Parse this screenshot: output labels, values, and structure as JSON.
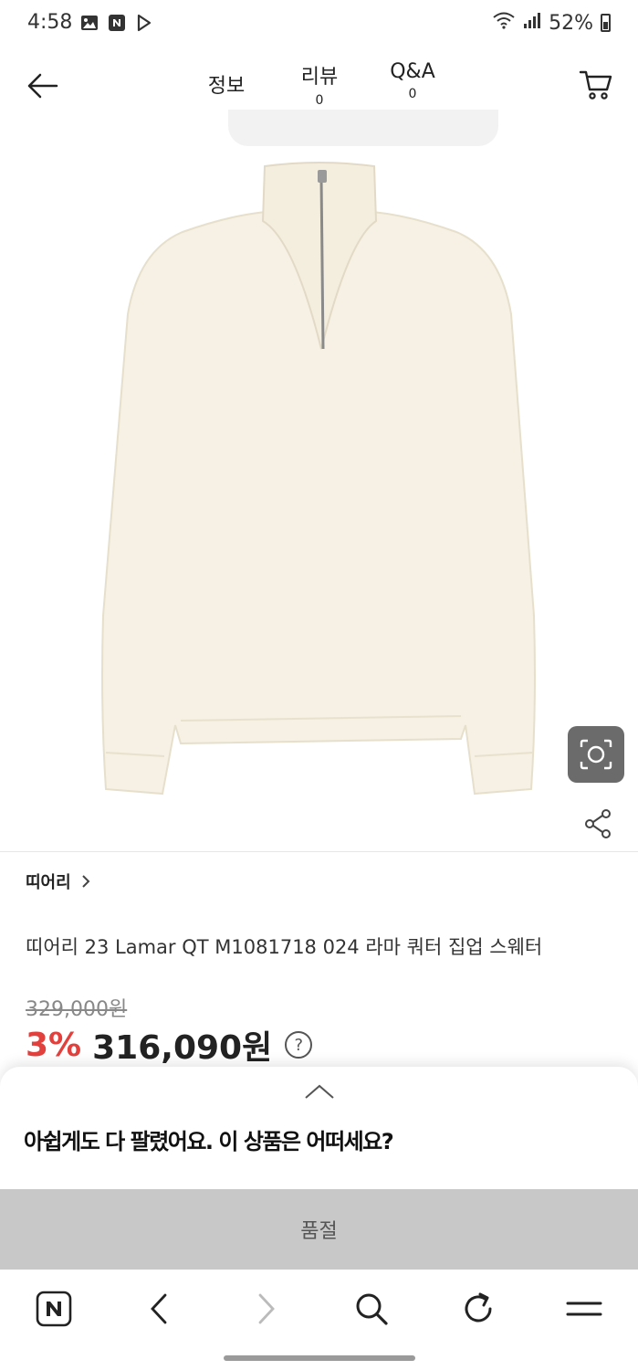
{
  "status_bar": {
    "time": "4:58",
    "battery": "52%",
    "icons": [
      "gallery-icon",
      "naver-n-icon",
      "play-store-icon",
      "wifi-icon",
      "signal-icon",
      "battery-icon"
    ]
  },
  "header": {
    "tabs": [
      {
        "label": "정보",
        "count": ""
      },
      {
        "label": "리뷰",
        "count": "0"
      },
      {
        "label": "Q&A",
        "count": "0"
      }
    ],
    "icons": [
      "back-arrow-icon",
      "cart-icon"
    ]
  },
  "product": {
    "brand": "띠어리",
    "title": "띠어리 23 Lamar QT M1081718 024 라마 쿼터 집업 스웨터",
    "original_price": "329,000원",
    "discount": "3%",
    "price": "316,090원",
    "help_symbol": "?",
    "image_color": "#f6f1e4"
  },
  "sheet": {
    "message": "아쉽게도 다 팔렸어요. 이 상품은 어떠세요?",
    "soldout_label": "품절"
  },
  "browser_bar": {
    "icons": [
      "naver-n-icon",
      "back-icon",
      "forward-icon",
      "search-icon",
      "refresh-icon",
      "menu-icon"
    ]
  },
  "colors": {
    "discount": "#e2403d",
    "soldout_bg": "#c8c8c8",
    "camera_bg": "#6b6b6b"
  }
}
